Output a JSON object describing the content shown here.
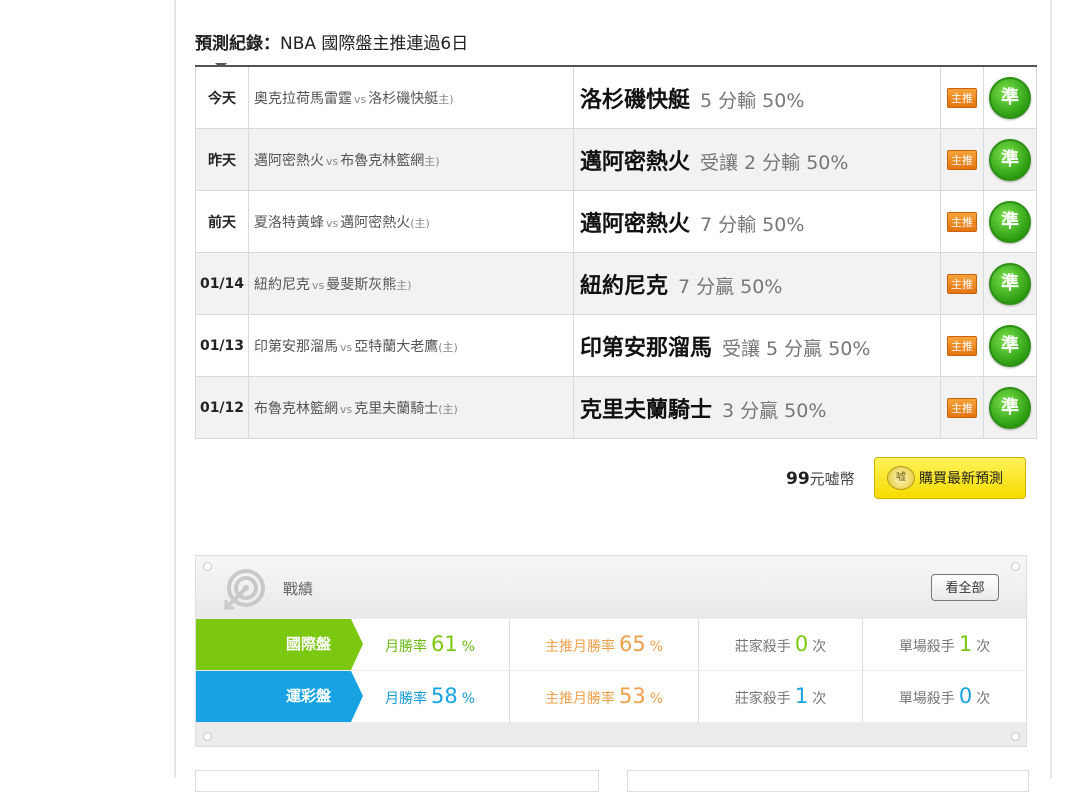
{
  "record": {
    "label": "預測紀錄：",
    "text": "NBA 國際盤主推連過6日"
  },
  "predictions": [
    {
      "date": "今天",
      "away": "奧克拉荷馬雷霆",
      "vs": "vs",
      "home": "洛杉磯快艇",
      "host_mark": "主)",
      "pick_team": "洛杉磯快艇",
      "pick_line": "5 分輸 50%",
      "badge": "主推",
      "result": "準"
    },
    {
      "date": "昨天",
      "away": "邁阿密熱火",
      "vs": "vs",
      "home": "布魯克林籃網",
      "host_mark": "主)",
      "pick_team": "邁阿密熱火",
      "pick_line": "受讓 2 分輸 50%",
      "badge": "主推",
      "result": "準"
    },
    {
      "date": "前天",
      "away": "夏洛特黃蜂",
      "vs": "vs",
      "home": "邁阿密熱火",
      "host_mark": "(主)",
      "pick_team": "邁阿密熱火",
      "pick_line": "7 分輸 50%",
      "badge": "主推",
      "result": "準"
    },
    {
      "date": "01/14",
      "away": "紐約尼克",
      "vs": "vs",
      "home": "曼斐斯灰熊",
      "host_mark": "主)",
      "pick_team": "紐約尼克",
      "pick_line": "7 分贏 50%",
      "badge": "主推",
      "result": "準"
    },
    {
      "date": "01/13",
      "away": "印第安那溜馬",
      "vs": "vs",
      "home": "亞特蘭大老鷹",
      "host_mark": "(主)",
      "pick_team": "印第安那溜馬",
      "pick_line": "受讓 5 分贏 50%",
      "badge": "主推",
      "result": "準"
    },
    {
      "date": "01/12",
      "away": "布魯克林籃網",
      "vs": "vs",
      "home": "克里夫蘭騎士",
      "host_mark": "(主)",
      "pick_team": "克里夫蘭騎士",
      "pick_line": "3 分贏 50%",
      "badge": "主推",
      "result": "準"
    }
  ],
  "purchase": {
    "price": "99",
    "currency": "元嘘幣",
    "coin_text": "嘘",
    "button_label": "購買最新預測"
  },
  "stats": {
    "title": "戰績",
    "view_all": "看全部",
    "rows": [
      {
        "name": "國際盤",
        "color": "#7cc710",
        "monthly_label": "月勝率",
        "monthly_value": "61",
        "monthly_unit": "%",
        "main_label": "主推月勝率",
        "main_value": "65",
        "main_unit": "%",
        "dealer_label": "莊家殺手",
        "dealer_value": "0",
        "dealer_unit": "次",
        "single_label": "單場殺手",
        "single_value": "1",
        "single_unit": "次"
      },
      {
        "name": "運彩盤",
        "color": "#17a3e3",
        "monthly_label": "月勝率",
        "monthly_value": "58",
        "monthly_unit": "%",
        "main_label": "主推月勝率",
        "main_value": "53",
        "main_unit": "%",
        "dealer_label": "莊家殺手",
        "dealer_value": "1",
        "dealer_unit": "次",
        "single_label": "單場殺手",
        "single_value": "0",
        "single_unit": "次"
      }
    ]
  },
  "icons": {
    "result": "check-correct-icon",
    "target": "target-icon",
    "coin": "coin-icon"
  }
}
